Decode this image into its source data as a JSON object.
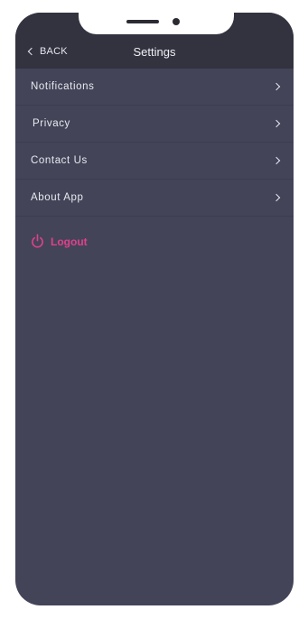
{
  "header": {
    "back_label": "BACK",
    "title": "Settings"
  },
  "menu": {
    "items": [
      {
        "label": "Notifications"
      },
      {
        "label": "Privacy"
      },
      {
        "label": "Contact Us"
      },
      {
        "label": "About App"
      }
    ]
  },
  "logout": {
    "label": "Logout",
    "color": "#e0418c"
  },
  "colors": {
    "background": "#434458",
    "header": "#333340"
  }
}
